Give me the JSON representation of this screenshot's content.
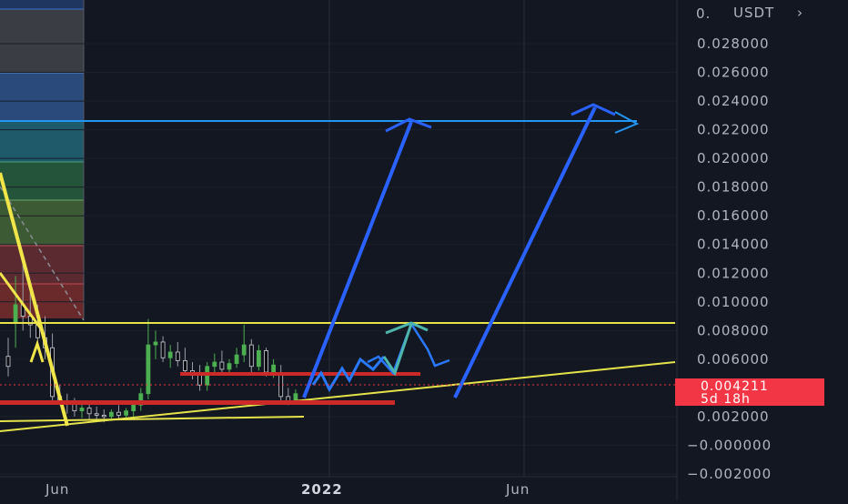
{
  "chart_data": {
    "type": "candlestick",
    "currency_label": "USDT",
    "y_ticks": [
      {
        "value": 0.028,
        "label": "0.028000"
      },
      {
        "value": 0.026,
        "label": "0.026000"
      },
      {
        "value": 0.024,
        "label": "0.024000"
      },
      {
        "value": 0.022,
        "label": "0.022000"
      },
      {
        "value": 0.02,
        "label": "0.020000"
      },
      {
        "value": 0.018,
        "label": "0.018000"
      },
      {
        "value": 0.016,
        "label": "0.016000"
      },
      {
        "value": 0.014,
        "label": "0.014000"
      },
      {
        "value": 0.012,
        "label": "0.012000"
      },
      {
        "value": 0.01,
        "label": "0.010000"
      },
      {
        "value": 0.008,
        "label": "0.008000"
      },
      {
        "value": 0.006,
        "label": "0.006000"
      },
      {
        "value": 0.002,
        "label": "0.002000"
      },
      {
        "value": 0.0,
        "label": "−0.000000"
      },
      {
        "value": -0.002,
        "label": "−0.002000"
      }
    ],
    "ylim": [
      -0.0024,
      0.0305
    ],
    "x_ticks": [
      "Jun",
      "2022",
      "Jun"
    ],
    "last_price": {
      "value": 0.004211,
      "label": "0.004211",
      "countdown": "5d 18h",
      "color": "#f23645"
    },
    "candles": [
      {
        "o": 0.0062,
        "h": 0.0075,
        "l": 0.0048,
        "c": 0.0055,
        "up": false
      },
      {
        "o": 0.0085,
        "h": 0.0118,
        "l": 0.0068,
        "c": 0.0098,
        "up": true
      },
      {
        "o": 0.0098,
        "h": 0.0132,
        "l": 0.008,
        "c": 0.009,
        "up": false
      },
      {
        "o": 0.009,
        "h": 0.011,
        "l": 0.0075,
        "c": 0.0084,
        "up": false
      },
      {
        "o": 0.0084,
        "h": 0.0098,
        "l": 0.007,
        "c": 0.0075,
        "up": false
      },
      {
        "o": 0.0075,
        "h": 0.009,
        "l": 0.006,
        "c": 0.0068,
        "up": false
      },
      {
        "o": 0.0068,
        "h": 0.0078,
        "l": 0.003,
        "c": 0.0034,
        "up": false
      },
      {
        "o": 0.0034,
        "h": 0.0042,
        "l": 0.0028,
        "c": 0.0031,
        "up": false
      },
      {
        "o": 0.0031,
        "h": 0.0036,
        "l": 0.0022,
        "c": 0.0029,
        "up": false
      },
      {
        "o": 0.0029,
        "h": 0.0033,
        "l": 0.002,
        "c": 0.0024,
        "up": false
      },
      {
        "o": 0.0024,
        "h": 0.003,
        "l": 0.0019,
        "c": 0.0026,
        "up": true
      },
      {
        "o": 0.0026,
        "h": 0.003,
        "l": 0.0018,
        "c": 0.0022,
        "up": false
      },
      {
        "o": 0.0022,
        "h": 0.0027,
        "l": 0.0017,
        "c": 0.0021,
        "up": false
      },
      {
        "o": 0.0021,
        "h": 0.0025,
        "l": 0.0016,
        "c": 0.002,
        "up": false
      },
      {
        "o": 0.002,
        "h": 0.0025,
        "l": 0.0017,
        "c": 0.0023,
        "up": true
      },
      {
        "o": 0.0023,
        "h": 0.0028,
        "l": 0.0019,
        "c": 0.0021,
        "up": false
      },
      {
        "o": 0.0021,
        "h": 0.0026,
        "l": 0.0018,
        "c": 0.0024,
        "up": true
      },
      {
        "o": 0.0024,
        "h": 0.003,
        "l": 0.002,
        "c": 0.0028,
        "up": true
      },
      {
        "o": 0.0028,
        "h": 0.004,
        "l": 0.0024,
        "c": 0.0036,
        "up": true
      },
      {
        "o": 0.0036,
        "h": 0.0088,
        "l": 0.0032,
        "c": 0.007,
        "up": true
      },
      {
        "o": 0.007,
        "h": 0.008,
        "l": 0.006,
        "c": 0.0072,
        "up": true
      },
      {
        "o": 0.0072,
        "h": 0.0076,
        "l": 0.0058,
        "c": 0.0061,
        "up": false
      },
      {
        "o": 0.0061,
        "h": 0.007,
        "l": 0.0054,
        "c": 0.0065,
        "up": true
      },
      {
        "o": 0.0065,
        "h": 0.0072,
        "l": 0.0055,
        "c": 0.0059,
        "up": false
      },
      {
        "o": 0.0059,
        "h": 0.0068,
        "l": 0.005,
        "c": 0.0052,
        "up": false
      },
      {
        "o": 0.0052,
        "h": 0.0058,
        "l": 0.0046,
        "c": 0.0049,
        "up": false
      },
      {
        "o": 0.0049,
        "h": 0.0056,
        "l": 0.0038,
        "c": 0.0042,
        "up": false
      },
      {
        "o": 0.0042,
        "h": 0.0058,
        "l": 0.0038,
        "c": 0.0055,
        "up": true
      },
      {
        "o": 0.0055,
        "h": 0.0064,
        "l": 0.005,
        "c": 0.0058,
        "up": true
      },
      {
        "o": 0.0058,
        "h": 0.0066,
        "l": 0.0051,
        "c": 0.0053,
        "up": false
      },
      {
        "o": 0.0053,
        "h": 0.006,
        "l": 0.0049,
        "c": 0.0057,
        "up": true
      },
      {
        "o": 0.0057,
        "h": 0.0068,
        "l": 0.0054,
        "c": 0.0063,
        "up": true
      },
      {
        "o": 0.0063,
        "h": 0.0084,
        "l": 0.0058,
        "c": 0.007,
        "up": true
      },
      {
        "o": 0.007,
        "h": 0.0074,
        "l": 0.005,
        "c": 0.0055,
        "up": false
      },
      {
        "o": 0.0055,
        "h": 0.007,
        "l": 0.0052,
        "c": 0.0066,
        "up": true
      },
      {
        "o": 0.0066,
        "h": 0.0068,
        "l": 0.0048,
        "c": 0.0051,
        "up": false
      },
      {
        "o": 0.0051,
        "h": 0.006,
        "l": 0.0047,
        "c": 0.0056,
        "up": true
      },
      {
        "o": 0.005,
        "h": 0.0056,
        "l": 0.003,
        "c": 0.0034,
        "up": false
      },
      {
        "o": 0.0034,
        "h": 0.004,
        "l": 0.0028,
        "c": 0.0031,
        "up": false
      },
      {
        "o": 0.0031,
        "h": 0.0039,
        "l": 0.0029,
        "c": 0.0036,
        "up": true
      }
    ],
    "colors": {
      "background": "#131722",
      "grid": "#1e222d",
      "axis_text": "#b2b5be",
      "candle_up": "#4caf50",
      "candle_down": "#000000",
      "candle_wick": "#d1d4dc",
      "resistance_line": "#e6e34a",
      "projection_arrow": "#2962ff",
      "target_line": "#2196f3",
      "support_zone": "#cc2929",
      "fib_fill": [
        "#3a3a40",
        "#2a3f6a",
        "#2e5c88",
        "#1f4a45",
        "#2c5e35",
        "#3a5a36",
        "#5a2a30",
        "#5a2228"
      ],
      "path_light": "#2979ff",
      "path_teal": "#4db6ac"
    }
  }
}
